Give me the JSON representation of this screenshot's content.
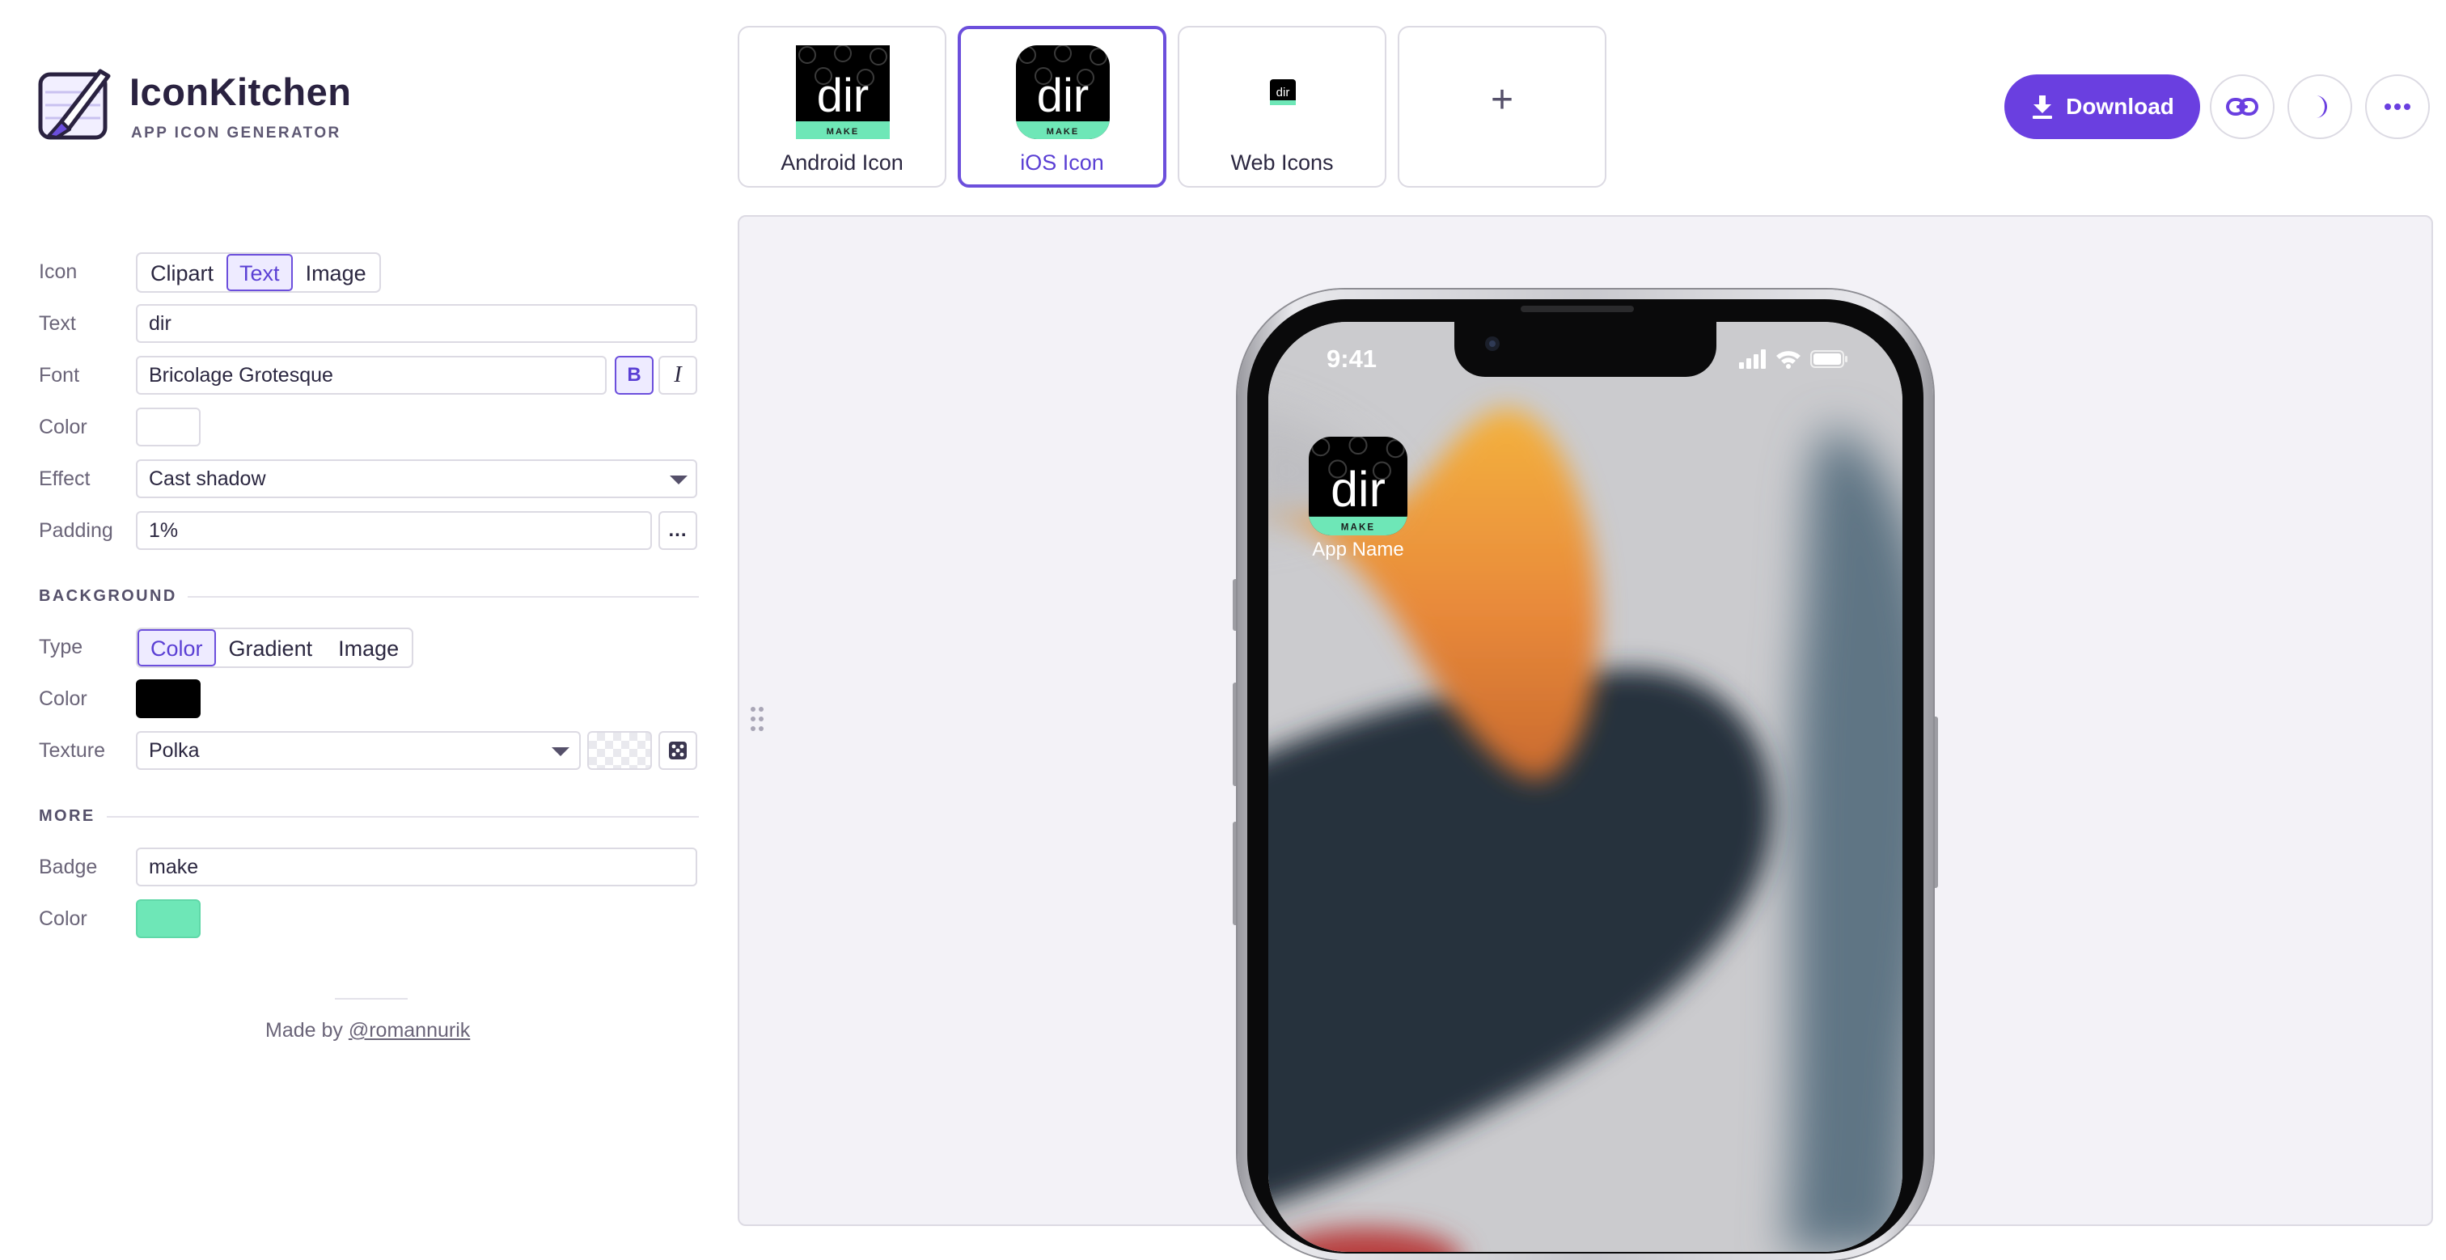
{
  "app": {
    "title": "IconKitchen",
    "subtitle": "APP ICON GENERATOR"
  },
  "tabs": [
    {
      "label": "Android Icon",
      "icon_text": "dir",
      "badge": "MAKE",
      "selected": false
    },
    {
      "label": "iOS Icon",
      "icon_text": "dir",
      "badge": "MAKE",
      "selected": true
    },
    {
      "label": "Web Icons",
      "icon_text": "dir",
      "selected": false
    },
    {
      "label": "+",
      "selected": false
    }
  ],
  "toolbar": {
    "download_label": "Download",
    "link_icon": "link-icon",
    "theme_icon": "moon-icon",
    "more_icon": "more-horizontal-icon",
    "accent_color": "#6a3fe0"
  },
  "form": {
    "icon": {
      "label": "Icon",
      "options": [
        "Clipart",
        "Text",
        "Image"
      ],
      "selected": "Text"
    },
    "text": {
      "label": "Text",
      "value": "dir"
    },
    "font": {
      "label": "Font",
      "value": "Bricolage Grotesque",
      "bold_label": "B",
      "italic_label": "I",
      "bold": true
    },
    "color": {
      "label": "Color",
      "value": "#ffffff"
    },
    "effect": {
      "label": "Effect",
      "value": "Cast shadow"
    },
    "padding": {
      "label": "Padding",
      "value": "1%",
      "more_label": "..."
    },
    "background": {
      "section_title": "BACKGROUND",
      "type": {
        "label": "Type",
        "options": [
          "Color",
          "Gradient",
          "Image"
        ],
        "selected": "Color"
      },
      "color": {
        "label": "Color",
        "value": "#000000"
      },
      "texture": {
        "label": "Texture",
        "value": "Polka"
      }
    },
    "more": {
      "section_title": "MORE",
      "badge": {
        "label": "Badge",
        "value": "make"
      },
      "color": {
        "label": "Color",
        "value": "#6ee7b7"
      }
    }
  },
  "footer": {
    "made_by": "Made by",
    "author": "@romannurik"
  },
  "preview": {
    "status_time": "9:41",
    "app_name": "App Name",
    "icon_text": "dir",
    "badge_text": "MAKE"
  }
}
